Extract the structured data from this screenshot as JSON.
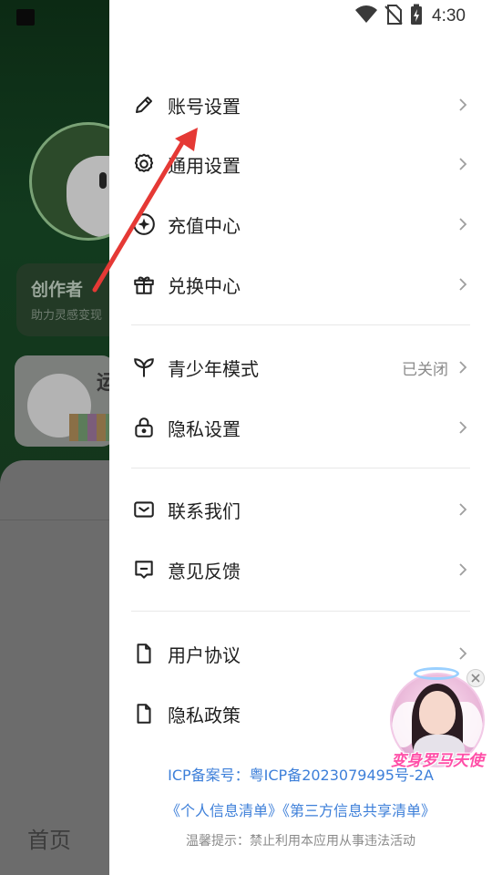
{
  "background": {
    "creator_title": "创作者",
    "creator_subtitle": "助力灵感变现",
    "card_title": "运",
    "home_tab": "首页"
  },
  "status_bar": {
    "time": "4:30",
    "icons": [
      "image-icon",
      "wifi-icon",
      "no-sim-icon",
      "battery-charging-icon"
    ]
  },
  "menu": {
    "section1": [
      {
        "label": "账号设置",
        "icon": "pencil-icon"
      },
      {
        "label": "通用设置",
        "icon": "gear-icon"
      },
      {
        "label": "充值中心",
        "icon": "sparkle-icon"
      },
      {
        "label": "兑换中心",
        "icon": "gift-icon"
      }
    ],
    "section2": [
      {
        "label": "青少年模式",
        "icon": "sprout-icon",
        "value": "已关闭"
      },
      {
        "label": "隐私设置",
        "icon": "lock-icon"
      }
    ],
    "section3": [
      {
        "label": "联系我们",
        "icon": "mail-icon"
      },
      {
        "label": "意见反馈",
        "icon": "feedback-icon"
      }
    ],
    "section4": [
      {
        "label": "用户协议",
        "icon": "document-icon"
      },
      {
        "label": "隐私政策",
        "icon": "document-icon"
      }
    ]
  },
  "footer": {
    "icp": "ICP备案号：粤ICP备2023079495号-2A",
    "link_personal_info": "《个人信息清单》",
    "link_third_party": "《第三方信息共享清单》",
    "tip": "温馨提示：禁止利用本应用从事违法活动"
  },
  "promo": {
    "title": "变身罗马天使"
  },
  "colors": {
    "accent_link": "#3d7fd9",
    "annotation_arrow": "#e53935",
    "promo_title": "#ff4fa8"
  }
}
